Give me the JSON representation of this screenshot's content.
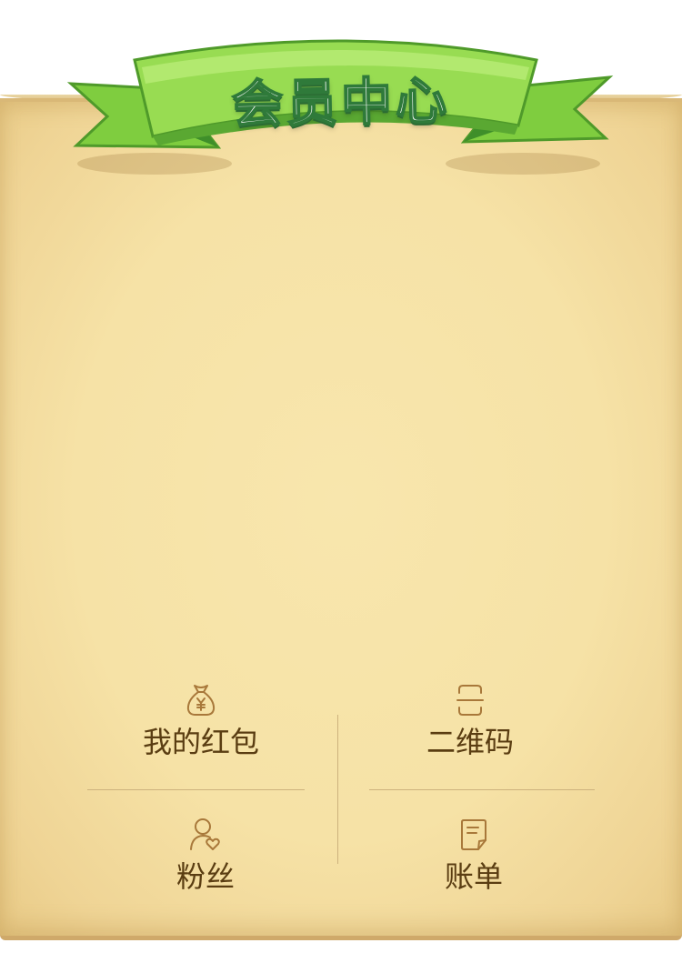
{
  "banner": {
    "title": "会员中心"
  },
  "menu": {
    "items": [
      {
        "label": "我的红包",
        "icon": "money-bag-icon"
      },
      {
        "label": "二维码",
        "icon": "qr-scan-icon"
      },
      {
        "label": "粉丝",
        "icon": "user-heart-icon"
      },
      {
        "label": "账单",
        "icon": "bill-icon"
      }
    ]
  },
  "colors": {
    "parchment": "#f6e2a6",
    "ribbon_green": "#8fd94f",
    "label_brown": "#5a3d12",
    "icon_brown": "#a8783a",
    "divider": "#cdb27d"
  }
}
